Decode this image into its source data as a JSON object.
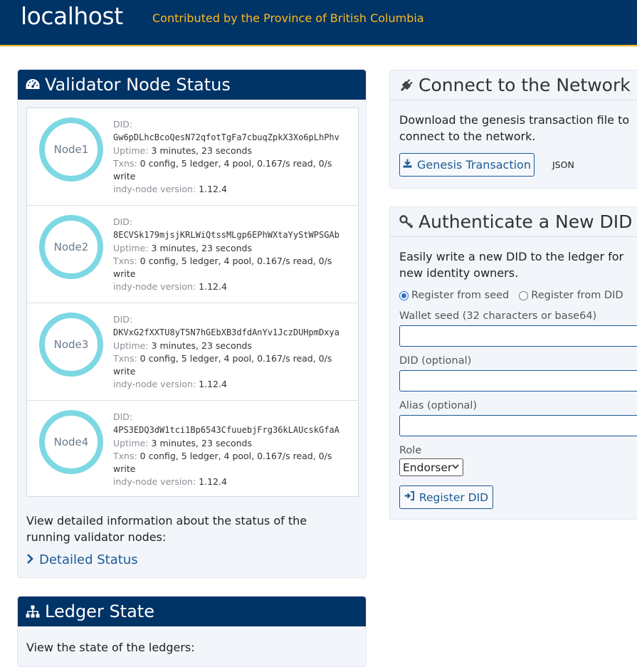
{
  "header": {
    "brand": "localhost",
    "contribution": "Contributed by the Province of British Columbia"
  },
  "validator": {
    "title": "Validator Node Status",
    "did_label": "DID:",
    "uptime_label": "Uptime:",
    "txns_label": "Txns:",
    "version_label": "indy-node version:",
    "nodes": [
      {
        "name": "Node1",
        "did": "Gw6pDLhcBcoQesN72qfotTgFa7cbuqZpkX3Xo6pLhPhv",
        "uptime": "3 minutes, 23 seconds",
        "txns": "0 config, 5 ledger, 4 pool, 0.167/s read, 0/s write",
        "version": "1.12.4"
      },
      {
        "name": "Node2",
        "did": "8ECVSk179mjsjKRLWiQtssMLgp6EPhWXtaYyStWPSGAb",
        "uptime": "3 minutes, 23 seconds",
        "txns": "0 config, 5 ledger, 4 pool, 0.167/s read, 0/s write",
        "version": "1.12.4"
      },
      {
        "name": "Node3",
        "did": "DKVxG2fXXTU8yT5N7hGEbXB3dfdAnYv1JczDUHpmDxya",
        "uptime": "3 minutes, 23 seconds",
        "txns": "0 config, 5 ledger, 4 pool, 0.167/s read, 0/s write",
        "version": "1.12.4"
      },
      {
        "name": "Node4",
        "did": "4PS3EDQ3dW1tci1Bp6543CfuuebjFrg36kLAUcskGfaA",
        "uptime": "3 minutes, 23 seconds",
        "txns": "0 config, 5 ledger, 4 pool, 0.167/s read, 0/s write",
        "version": "1.12.4"
      }
    ],
    "description": "View detailed information about the status of the running validator nodes:",
    "detail_link": "Detailed Status"
  },
  "ledger": {
    "title": "Ledger State",
    "text": "View the state of the ledgers:"
  },
  "connect": {
    "title": "Connect to the Network",
    "text": "Download the genesis transaction file to connect to the network.",
    "genesis_button": "Genesis Transaction",
    "json_label": "JSON"
  },
  "auth": {
    "title": "Authenticate a New DID",
    "text": "Easily write a new DID to the ledger for new identity owners.",
    "radio_seed": "Register from seed",
    "radio_did": "Register from DID",
    "seed_label": "Wallet seed (32 characters or base64)",
    "did_label": "DID (optional)",
    "alias_label": "Alias (optional)",
    "role_label": "Role",
    "role_value": "Endorser",
    "register_button": "Register DID"
  },
  "colors": {
    "header_bg": "#003366",
    "accent": "#fcba19",
    "link": "#1a5a96",
    "ring": "#7dd8e3"
  }
}
